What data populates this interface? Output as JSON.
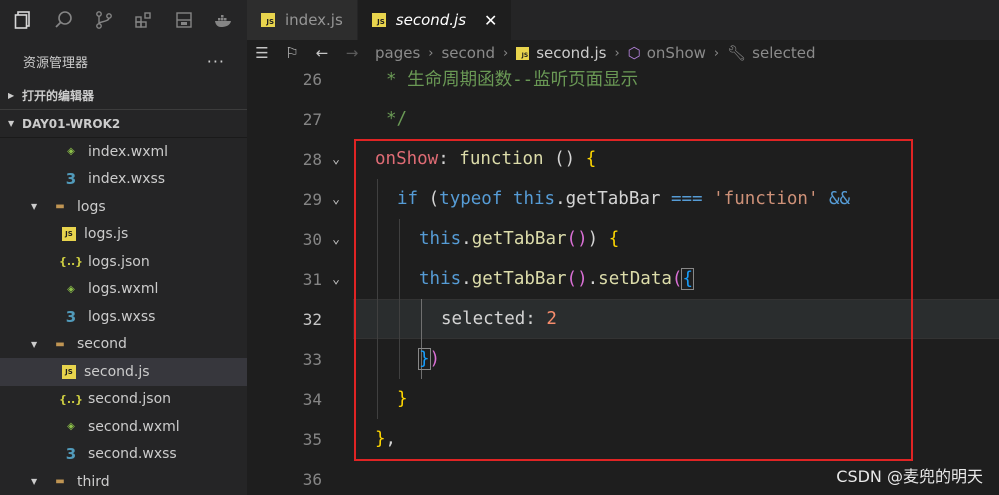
{
  "activity_bar": {
    "icons": [
      "files-icon",
      "search-icon",
      "source-control-icon",
      "extensions-icon",
      "remote-explorer-icon",
      "docker-icon"
    ]
  },
  "explorer": {
    "title": "资源管理器",
    "more": "···",
    "open_editors_label": "打开的编辑器",
    "project_label": "DAY01-WROK2",
    "tree": [
      {
        "label": "index.wxml",
        "type": "wxml",
        "depth": 2
      },
      {
        "label": "index.wxss",
        "type": "css",
        "depth": 2
      },
      {
        "label": "logs",
        "type": "folder",
        "depth": 1,
        "expanded": true
      },
      {
        "label": "logs.js",
        "type": "js",
        "depth": 2
      },
      {
        "label": "logs.json",
        "type": "json",
        "depth": 2
      },
      {
        "label": "logs.wxml",
        "type": "wxml",
        "depth": 2
      },
      {
        "label": "logs.wxss",
        "type": "css",
        "depth": 2
      },
      {
        "label": "second",
        "type": "folder",
        "depth": 1,
        "expanded": true
      },
      {
        "label": "second.js",
        "type": "js",
        "depth": 2,
        "selected": true
      },
      {
        "label": "second.json",
        "type": "json",
        "depth": 2
      },
      {
        "label": "second.wxml",
        "type": "wxml",
        "depth": 2
      },
      {
        "label": "second.wxss",
        "type": "css",
        "depth": 2
      },
      {
        "label": "third",
        "type": "folder",
        "depth": 1,
        "expanded": true
      }
    ]
  },
  "tabs": [
    {
      "label": "index.js",
      "active": false
    },
    {
      "label": "second.js",
      "active": true,
      "close": "✕"
    }
  ],
  "breadcrumb": {
    "items": [
      "pages",
      "second",
      "second.js",
      "onShow",
      "selected"
    ]
  },
  "editor": {
    "lines": [
      {
        "num": "26",
        "fold": ""
      },
      {
        "num": "27",
        "fold": ""
      },
      {
        "num": "28",
        "fold": "v"
      },
      {
        "num": "29",
        "fold": "v"
      },
      {
        "num": "30",
        "fold": "v"
      },
      {
        "num": "31",
        "fold": "v"
      },
      {
        "num": "32",
        "fold": ""
      },
      {
        "num": "33",
        "fold": ""
      },
      {
        "num": "34",
        "fold": ""
      },
      {
        "num": "35",
        "fold": ""
      },
      {
        "num": "36",
        "fold": ""
      }
    ],
    "code": {
      "l26_comment": "* 生命周期函数--监听页面显示",
      "l27_comment": "*/",
      "l28_name": "onShow",
      "l28_colon": ": ",
      "l28_kw": "function",
      "l28_rest": " () ",
      "l28_brace": "{",
      "l29_if": "if",
      "l29_paren": " (",
      "l29_typeof": "typeof",
      "l29_this": " this",
      "l29_dot": ".",
      "l29_prop": "getTabBar",
      "l29_eq": " === ",
      "l29_str": "'function'",
      "l29_and": " &&",
      "l30_this": "this",
      "l30_dot": ".",
      "l30_fn": "getTabBar",
      "l30_call": "()",
      "l30_close": ") ",
      "l30_brace": "{",
      "l31_this": "this",
      "l31_dot": ".",
      "l31_fn": "getTabBar",
      "l31_call": "()",
      "l31_dot2": ".",
      "l31_fn2": "setData",
      "l31_paren": "(",
      "l31_brace": "{",
      "l32_key": "selected",
      "l32_colon": ": ",
      "l32_val": "2",
      "l33_brace": "}",
      "l33_paren": ")",
      "l34_brace": "}",
      "l35_brace": "}",
      "l35_comma": ","
    }
  },
  "watermark": "CSDN @麦兜的明天",
  "colors": {
    "highlight_box": "#e02424",
    "keyword": "#569cd6",
    "function": "#dcdcaa",
    "string": "#ce9178",
    "comment": "#6a9955"
  }
}
